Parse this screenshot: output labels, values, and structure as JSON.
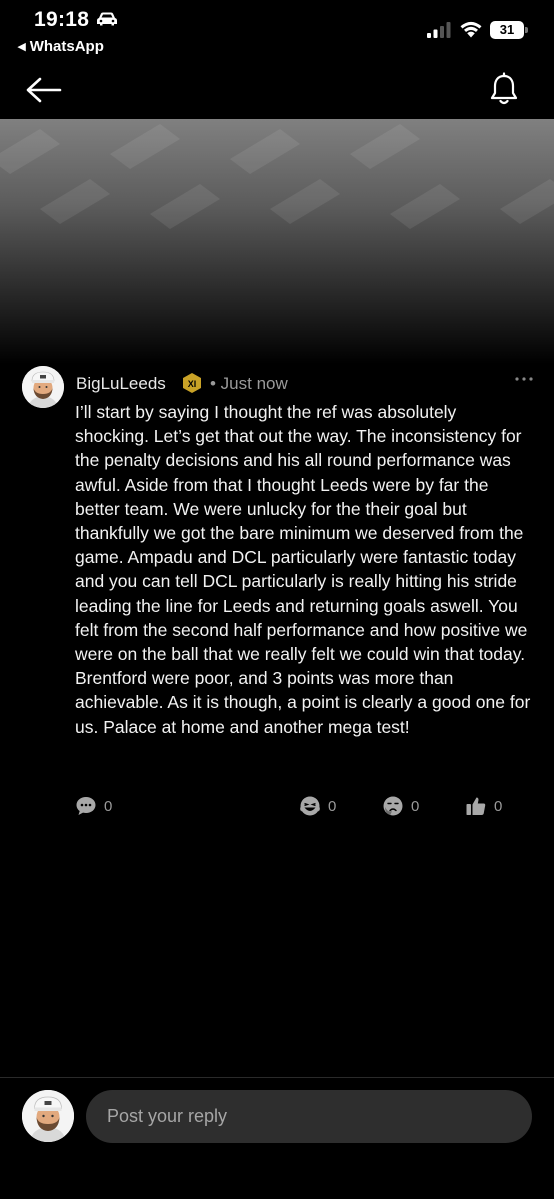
{
  "status_bar": {
    "time": "19:18",
    "back_app": "◂ WhatsApp",
    "battery": "31",
    "icons": [
      "car-icon",
      "signal-icon",
      "wifi-icon",
      "battery-icon"
    ]
  },
  "nav": {
    "icons": [
      "back-arrow-icon",
      "bell-icon"
    ]
  },
  "post": {
    "username": "BigLuLeeds",
    "badge": "XI",
    "timestamp": "• Just now",
    "body": "I’ll start by saying I thought the ref was absolutely shocking. Let’s get that out the way. The inconsistency for the penalty decisions and his all round performance was awful. Aside from that I thought Leeds were by far the better team. We were unlucky for the their goal but thankfully we got the bare minimum we deserved from the game. Ampadu and DCL particularly were fantastic today and you can tell DCL particularly is really hitting his stride leading the line for Leeds and returning goals aswell. You felt from the second half performance and how positive we were on the ball that we really felt we could win that today. Brentford were poor, and 3 points was more than achievable. As it is though, a point is clearly a good one for us. Palace at home and another mega test!",
    "reactions": {
      "comments": "0",
      "laugh": "0",
      "unamused": "0",
      "thumbs_up": "0"
    }
  },
  "reply": {
    "placeholder": "Post your reply"
  },
  "colors": {
    "background": "#000000",
    "secondary_text": "#9a9a9a",
    "badge_gold": "#c9a227",
    "input_bg": "#2e2e2e"
  }
}
